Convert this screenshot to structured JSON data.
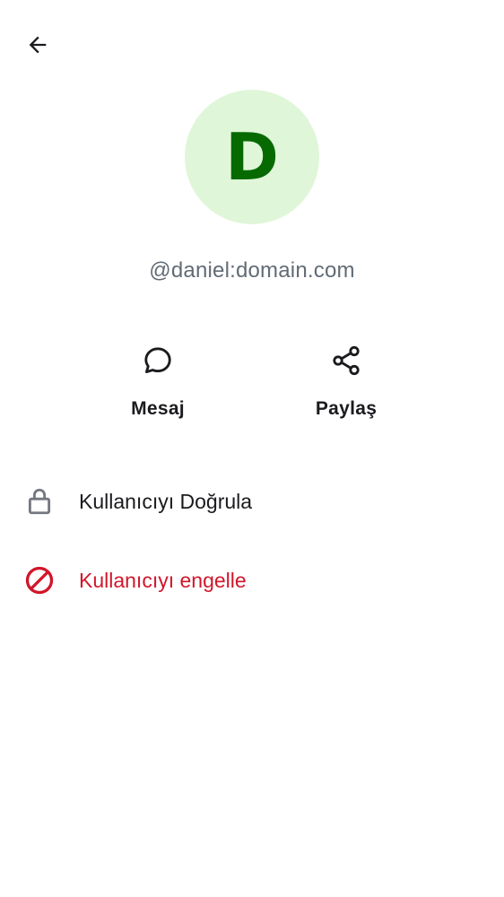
{
  "header": {
    "back_icon": "arrow-left-icon"
  },
  "profile": {
    "avatar_initial": "D",
    "avatar_bg": "#dff6d8",
    "avatar_fg": "#066a00",
    "user_id": "@daniel:domain.com"
  },
  "actions": [
    {
      "label": "Mesaj",
      "icon": "chat-bubble-icon"
    },
    {
      "label": "Paylaş",
      "icon": "share-icon"
    }
  ],
  "menu": [
    {
      "label": "Kullanıcıyı Doğrula",
      "icon": "lock-icon",
      "color": "#1b1b1f"
    },
    {
      "label": "Kullanıcıyı engelle",
      "icon": "block-icon",
      "color": "#d1162b"
    }
  ]
}
